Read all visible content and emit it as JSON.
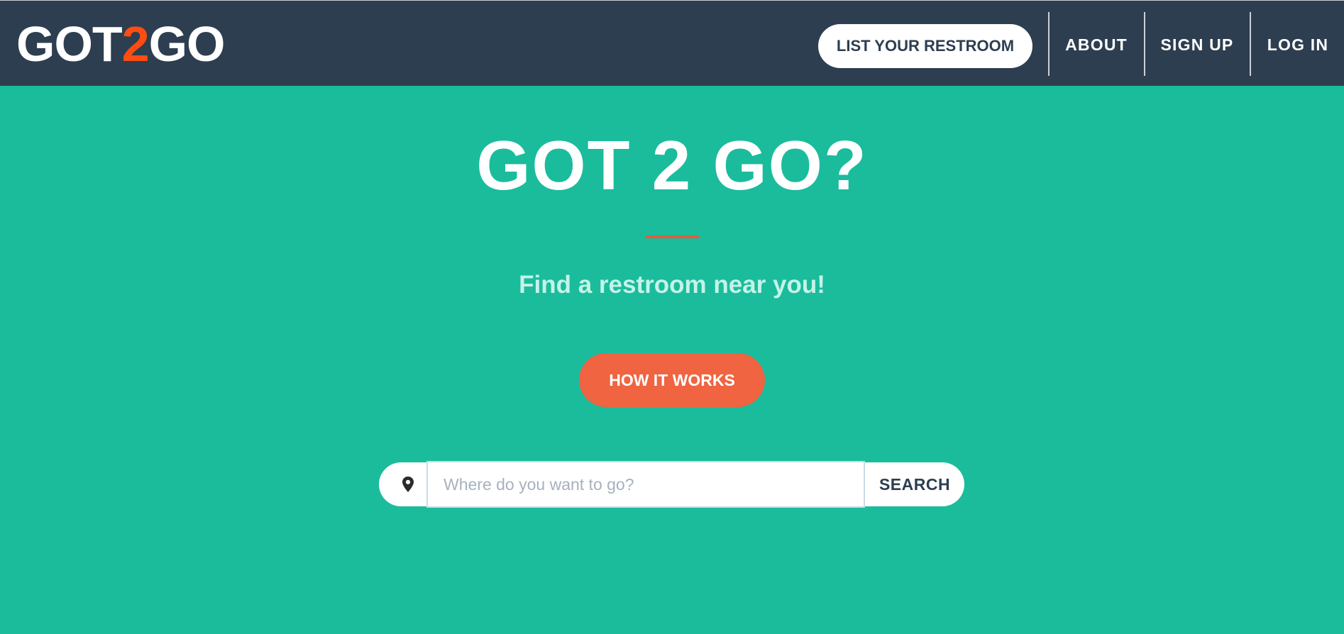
{
  "brand": {
    "prefix": "GOT",
    "number": "2",
    "suffix": "GO",
    "accent_color": "#ff4d12"
  },
  "nav": {
    "list_restroom": "LIST YOUR RESTROOM",
    "about": "ABOUT",
    "sign_up": "SIGN UP",
    "log_in": "LOG IN"
  },
  "hero": {
    "title": "GOT 2 GO?",
    "subtitle": "Find a restroom near you!",
    "cta": "HOW IT WORKS"
  },
  "search": {
    "icon": "map-pin-icon",
    "placeholder": "Where do you want to go?",
    "value": "",
    "button": "SEARCH"
  },
  "colors": {
    "navbar": "#2d3e50",
    "background": "#1abc9c",
    "cta": "#f06441",
    "rule": "#e55b3c"
  }
}
